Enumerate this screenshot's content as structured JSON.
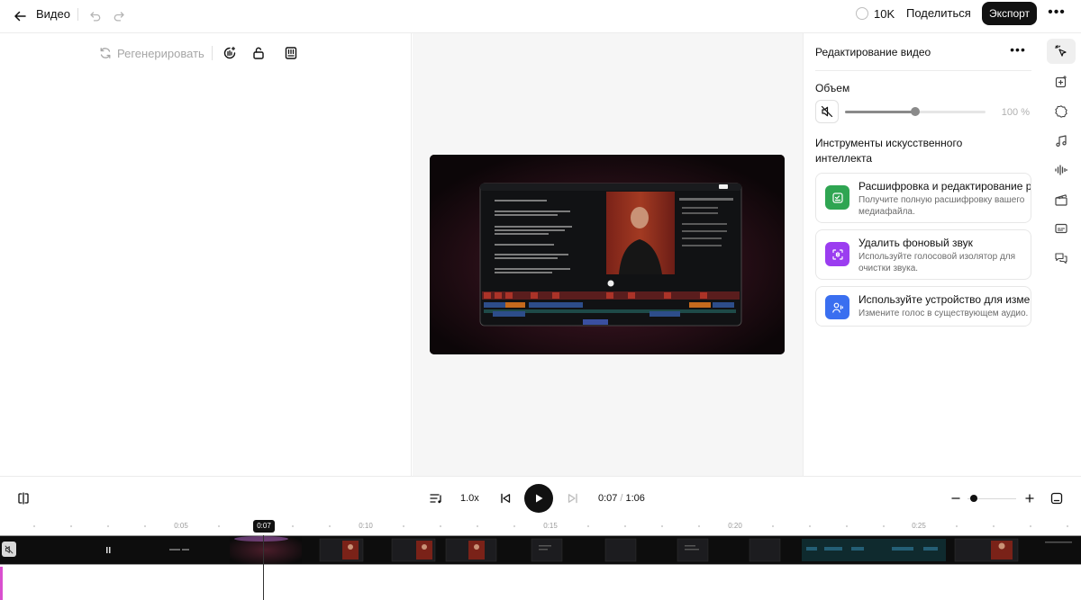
{
  "topbar": {
    "title": "Видео",
    "credits": "10K",
    "share_label": "Поделиться",
    "export_label": "Экспорт",
    "more_label": "•••"
  },
  "toolbar": {
    "regenerate_label": "Регенерировать"
  },
  "panel": {
    "title": "Редактирование видео",
    "more_label": "•••",
    "volume_label": "Объем",
    "volume_value": "100 %",
    "volume_level": 0.5,
    "ai_tools_label": "Инструменты искусственного интеллекта",
    "cards": [
      {
        "title": "Расшифровка и редактирование речи",
        "subtitle": "Получите полную расшифровку вашего медиафайла.",
        "color": "#2fa552",
        "icon": "transcript-icon"
      },
      {
        "title": "Удалить фоновый звук",
        "subtitle": "Используйте голосовой изолятор для очистки звука.",
        "color": "#9b3df0",
        "icon": "voice-isolator-icon"
      },
      {
        "title": "Используйте устройство для изменения голоса",
        "subtitle": "Измените голос в существующем аудио.",
        "color": "#3a6ff0",
        "icon": "voice-changer-icon"
      }
    ]
  },
  "transport": {
    "speed": "1.0x",
    "current_time": "0:07",
    "separator": "/",
    "duration": "1:06"
  },
  "timeline": {
    "labels": [
      "0:05",
      "0:10",
      "0:15",
      "0:20",
      "0:25"
    ],
    "playhead_label": "0:07"
  },
  "colors": {
    "accent": "#111111",
    "video_bg": "#0e0709"
  }
}
